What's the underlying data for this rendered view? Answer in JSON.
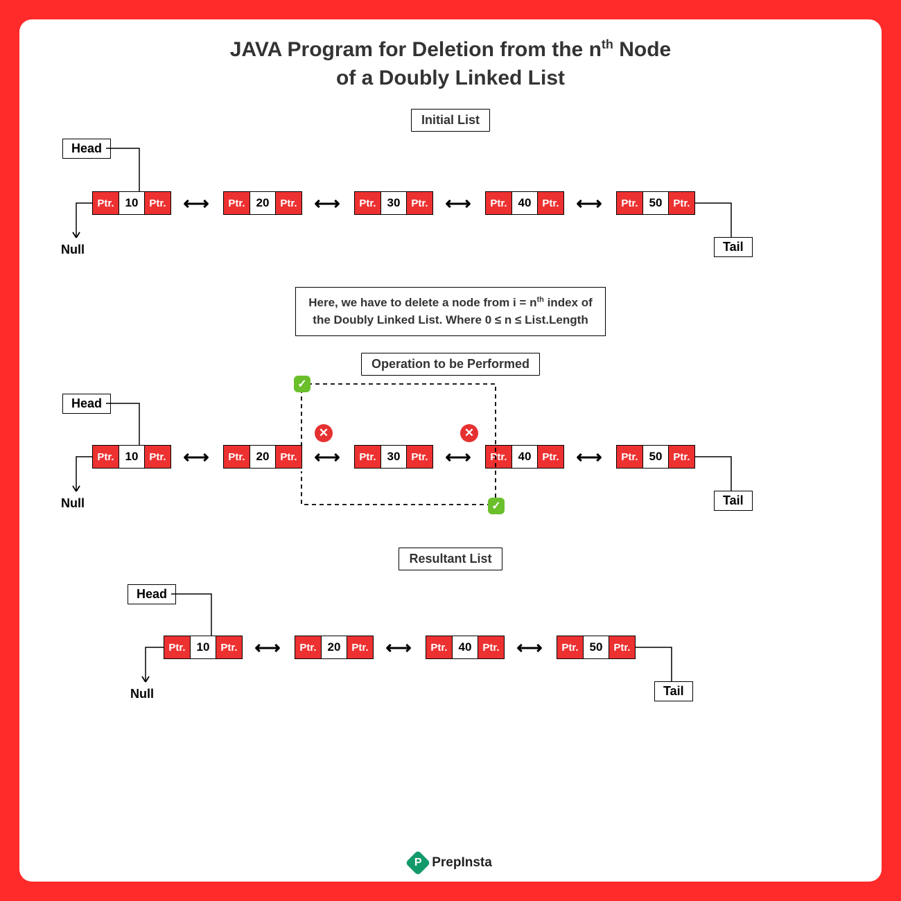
{
  "title_line1": "JAVA Program for Deletion from the n",
  "title_sup": "th",
  "title_line1_end": " Node",
  "title_line2": "of a Doubly Linked List",
  "sections": {
    "initial": "Initial List",
    "operation": "Operation to be Performed",
    "result": "Resultant List"
  },
  "labels": {
    "head": "Head",
    "tail": "Tail",
    "null": "Null",
    "ptr": "Ptr."
  },
  "info_text_a": "Here, we have to delete a node from i = n",
  "info_sup": "th",
  "info_text_b": " index of",
  "info_text_c": "the Doubly Linked List. Where 0 ≤ n ≤ List.Length",
  "chart_data": {
    "type": "linked-list-diagram",
    "initial_list": [
      10,
      20,
      30,
      40,
      50
    ],
    "deleted_index": 2,
    "deleted_value": 30,
    "resultant_list": [
      10,
      20,
      40,
      50
    ],
    "operation": "delete nth node",
    "pointers": {
      "head_points_to": 10,
      "tail_points_to": 50,
      "head_prev": "Null"
    },
    "markers": {
      "removed_connections": [
        [
          20,
          30
        ],
        [
          30,
          40
        ]
      ],
      "new_connection": [
        20,
        40
      ]
    }
  },
  "brand": "PrepInsta"
}
